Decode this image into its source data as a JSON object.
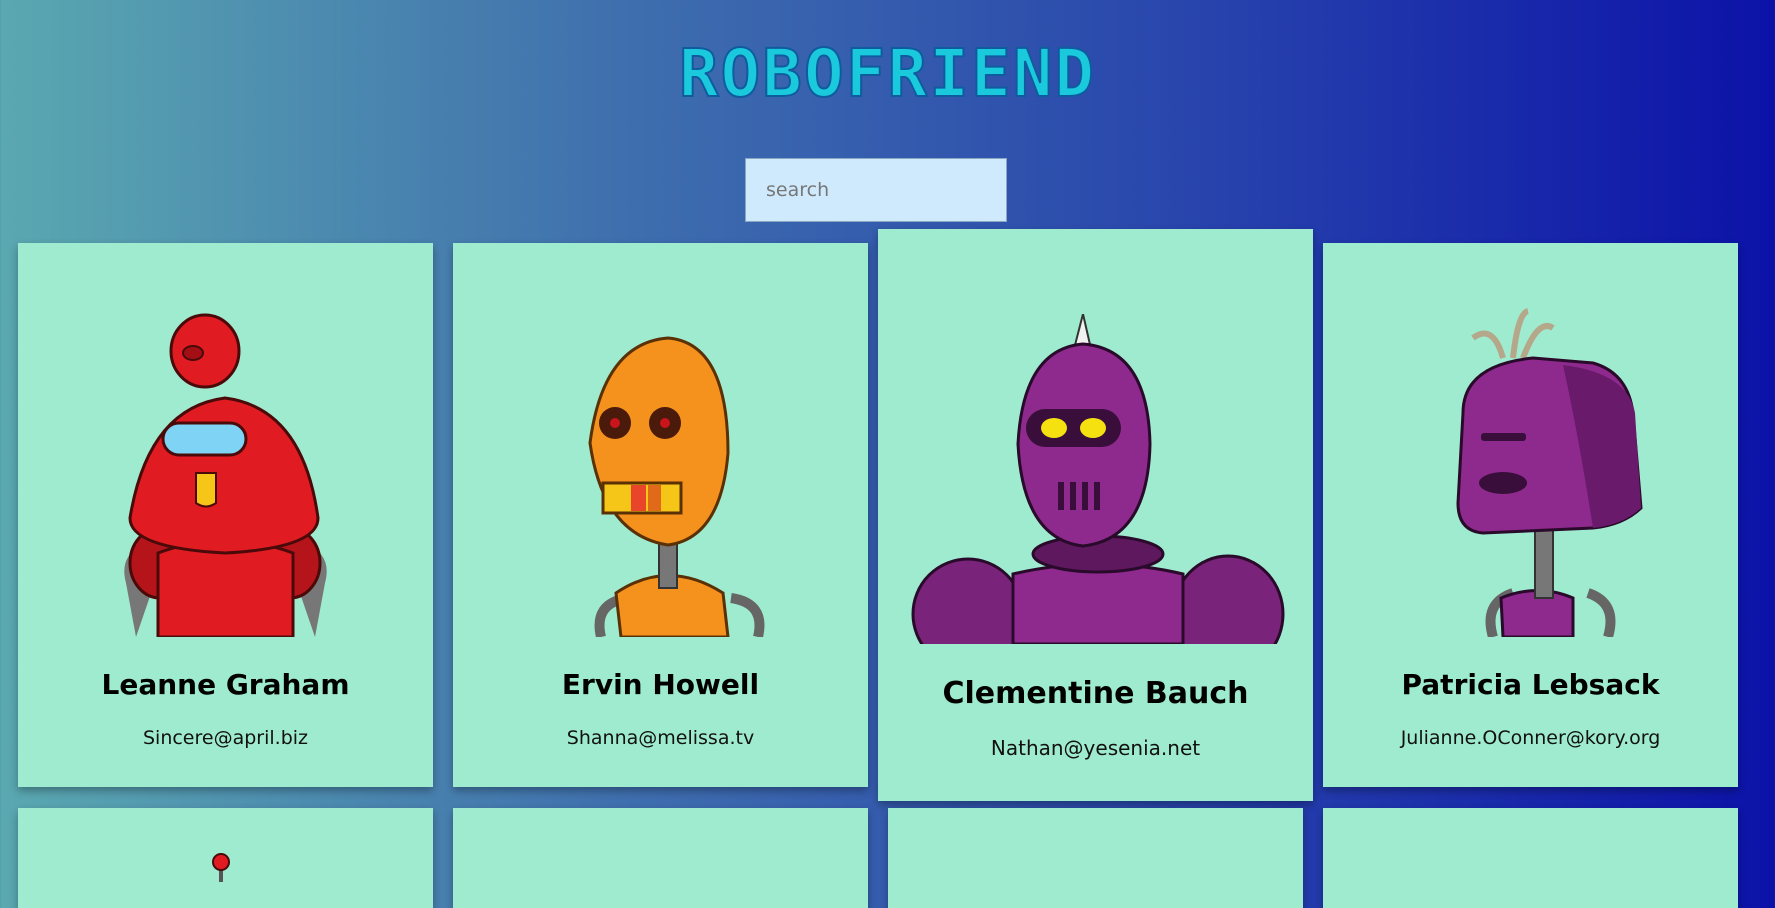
{
  "app": {
    "title": "ROBOFRIEND"
  },
  "search": {
    "placeholder": "search",
    "value": ""
  },
  "robots": [
    {
      "name": "Leanne Graham",
      "email": "Sincere@april.biz",
      "color": "#e11b22"
    },
    {
      "name": "Ervin Howell",
      "email": "Shanna@melissa.tv",
      "color": "#f5921e"
    },
    {
      "name": "Clementine Bauch",
      "email": "Nathan@yesenia.net",
      "color": "#8e2a8e"
    },
    {
      "name": "Patricia Lebsack",
      "email": "Julianne.OConner@kory.org",
      "color": "#8e2a8e"
    }
  ],
  "colors": {
    "card": "#9febd0",
    "title": "#1ac9dc",
    "search_bg": "#cfeafd"
  }
}
